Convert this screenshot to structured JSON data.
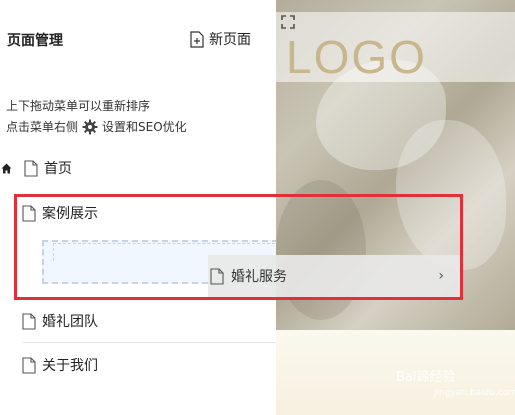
{
  "panel": {
    "title": "页面管理",
    "new_page_label": "新页面",
    "hint_line1": "上下拖动菜单可以重新排序",
    "hint_line2_prefix": "点击菜单右侧",
    "hint_line2_suffix": "设置和SEO优化"
  },
  "pages": {
    "home": "首页",
    "case": "案例展示",
    "team": "婚礼团队",
    "about": "关于我们"
  },
  "dragging": {
    "label": "婚礼服务",
    "chevron": "›"
  },
  "preview": {
    "logo": "LOGO"
  },
  "colors": {
    "highlight_frame": "#e0303a",
    "drop_slot_border": "#c7d3e3",
    "logo_color": "#c8b78c"
  }
}
